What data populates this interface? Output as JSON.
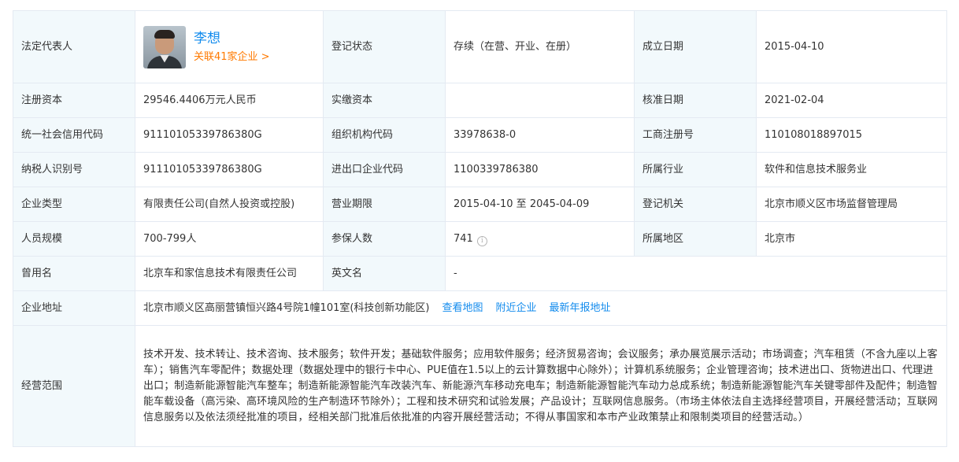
{
  "legal_rep": {
    "label": "法定代表人",
    "name": "李想",
    "related": "关联41家企业 >"
  },
  "registration_status": {
    "label": "登记状态",
    "value": "存续（在营、开业、在册）"
  },
  "established_date": {
    "label": "成立日期",
    "value": "2015-04-10"
  },
  "registered_capital": {
    "label": "注册资本",
    "value": "29546.4406万元人民币"
  },
  "paid_capital": {
    "label": "实缴资本",
    "value": ""
  },
  "approval_date": {
    "label": "核准日期",
    "value": "2021-02-04"
  },
  "credit_code": {
    "label": "统一社会信用代码",
    "value": "91110105339786380G"
  },
  "org_code": {
    "label": "组织机构代码",
    "value": "33978638-0"
  },
  "business_reg_no": {
    "label": "工商注册号",
    "value": "110108018897015"
  },
  "taxpayer_id": {
    "label": "纳税人识别号",
    "value": "91110105339786380G"
  },
  "import_export_code": {
    "label": "进出口企业代码",
    "value": "1100339786380"
  },
  "industry": {
    "label": "所属行业",
    "value": "软件和信息技术服务业"
  },
  "company_type": {
    "label": "企业类型",
    "value": "有限责任公司(自然人投资或控股)"
  },
  "business_term": {
    "label": "营业期限",
    "value": "2015-04-10 至 2045-04-09"
  },
  "registration_authority": {
    "label": "登记机关",
    "value": "北京市顺义区市场监督管理局"
  },
  "staff_size": {
    "label": "人员规模",
    "value": "700-799人"
  },
  "insured_count": {
    "label": "参保人数",
    "value": "741",
    "info_icon": "info-circle-icon"
  },
  "region": {
    "label": "所属地区",
    "value": "北京市"
  },
  "former_name": {
    "label": "曾用名",
    "value": "北京车和家信息技术有限责任公司"
  },
  "english_name": {
    "label": "英文名",
    "value": "-"
  },
  "address": {
    "label": "企业地址",
    "value": "北京市顺义区高丽营镇恒兴路4号院1幢101室(科技创新功能区)",
    "links": [
      "查看地图",
      "附近企业",
      "最新年报地址"
    ]
  },
  "business_scope": {
    "label": "经营范围",
    "value": "技术开发、技术转让、技术咨询、技术服务；软件开发；基础软件服务；应用软件服务；经济贸易咨询；会议服务；承办展览展示活动；市场调查；汽车租赁（不含九座以上客车）；销售汽车零配件；数据处理（数据处理中的银行卡中心、PUE值在1.5以上的云计算数据中心除外）；计算机系统服务；企业管理咨询；技术进出口、货物进出口、代理进出口；制造新能源智能汽车整车；制造新能源智能汽车改装汽车、新能源汽车移动充电车；制造新能源智能汽车动力总成系统；制造新能源智能汽车关键零部件及配件；制造智能车载设备（高污染、高环境风险的生产制造环节除外）；工程和技术研究和试验发展；产品设计；互联网信息服务。（市场主体依法自主选择经营项目，开展经营活动；互联网信息服务以及依法须经批准的项目，经相关部门批准后依批准的内容开展经营活动；不得从事国家和本市产业政策禁止和限制类项目的经营活动。）"
  },
  "colors": {
    "label_bg": "#f2f9fc",
    "border": "#e4eaf2",
    "link": "#128bed",
    "orange": "#ff7a00"
  }
}
